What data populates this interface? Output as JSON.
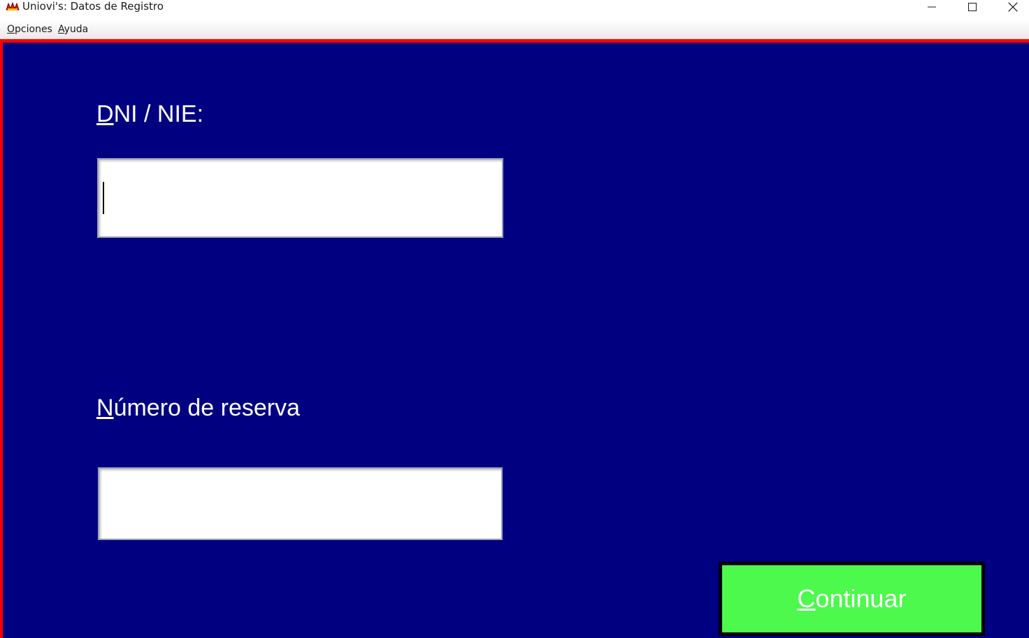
{
  "window": {
    "title": "Uniovi's: Datos de Registro",
    "icon": "app-logo-icon"
  },
  "menu": {
    "items": [
      {
        "mnemonic": "O",
        "rest": "pciones"
      },
      {
        "mnemonic": "A",
        "rest": "yuda"
      }
    ]
  },
  "form": {
    "dni_label": {
      "mnemonic": "D",
      "rest": "NI / NIE:"
    },
    "dni_value": "",
    "reserva_label": {
      "mnemonic": "N",
      "rest": "úmero de reserva"
    },
    "reserva_value": "",
    "continue_button": {
      "mnemonic": "C",
      "rest": "ontinuar"
    }
  },
  "colors": {
    "background": "#000080",
    "border": "#ff0000",
    "button": "#4cf94c"
  }
}
